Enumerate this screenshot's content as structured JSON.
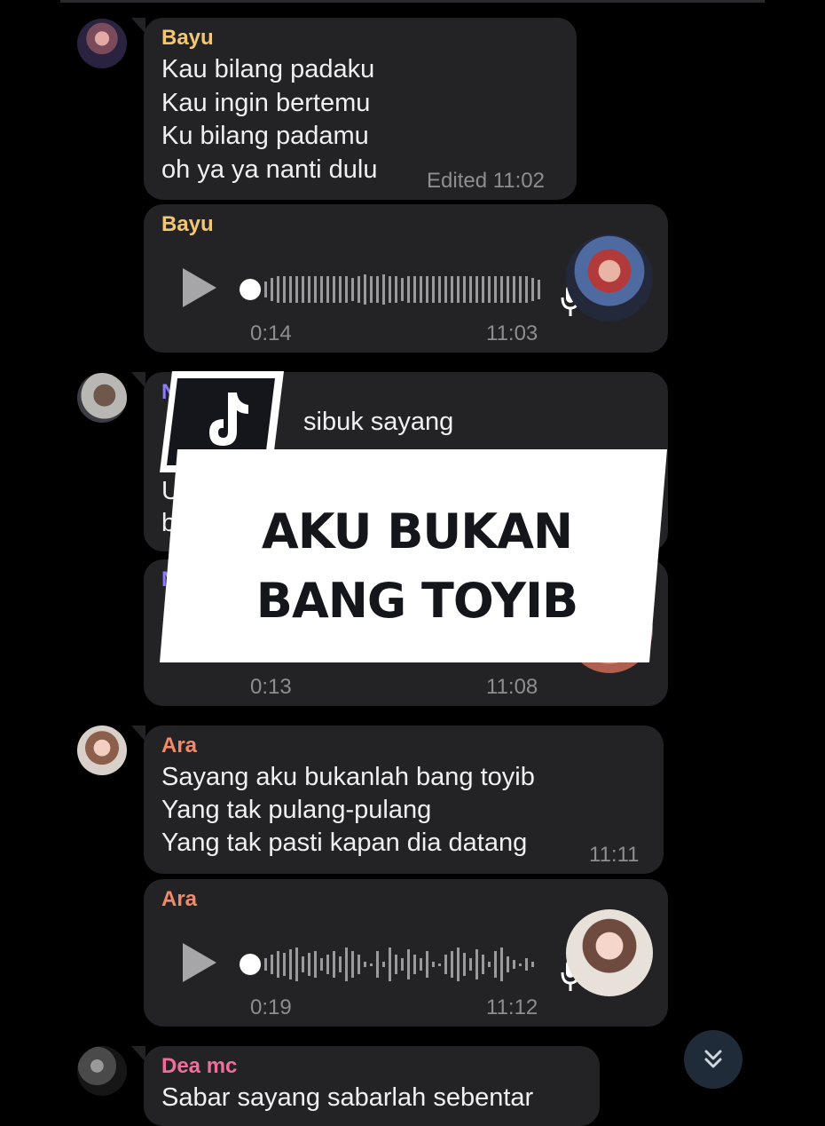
{
  "messages": [
    {
      "sender": "Bayu",
      "lines": [
        "Kau bilang padaku",
        "Kau ingin bertemu",
        "Ku bilang padamu",
        "oh ya ya nanti dulu"
      ],
      "time": "Edited 11:02"
    },
    {
      "sender": "Bayu",
      "voice_duration": "0:14",
      "time": "11:03"
    },
    {
      "sender": "N",
      "line_fragment": "sibuk sayang",
      "line_fragment_2": "U",
      "line_fragment_3": "b"
    },
    {
      "sender": "N",
      "voice_duration": "0:13",
      "time": "11:08"
    },
    {
      "sender": "Ara",
      "lines": [
        "Sayang aku bukanlah bang toyib",
        "Yang tak pulang-pulang",
        "Yang tak pasti kapan dia datang"
      ],
      "time": "11:11"
    },
    {
      "sender": "Ara",
      "voice_duration": "0:19",
      "time": "11:12"
    },
    {
      "sender": "Dea mc",
      "lines": [
        "Sabar sayang sabarlah sebentar"
      ]
    }
  ],
  "overlay": {
    "line1": "AKU BUKAN",
    "line2": "BANG TOYIB",
    "logo_icon": "tiktok-logo-icon"
  },
  "icons": {
    "play": "play-icon",
    "mic": "mic-icon",
    "scroll_down": "double-chevron-down-icon"
  },
  "colors": {
    "background": "#000000",
    "bubble": "#232325",
    "bayu_name": "#f1c776",
    "ara_name": "#f18a6a",
    "dea_name": "#f06d9c",
    "n_name": "#8e7cf7"
  }
}
